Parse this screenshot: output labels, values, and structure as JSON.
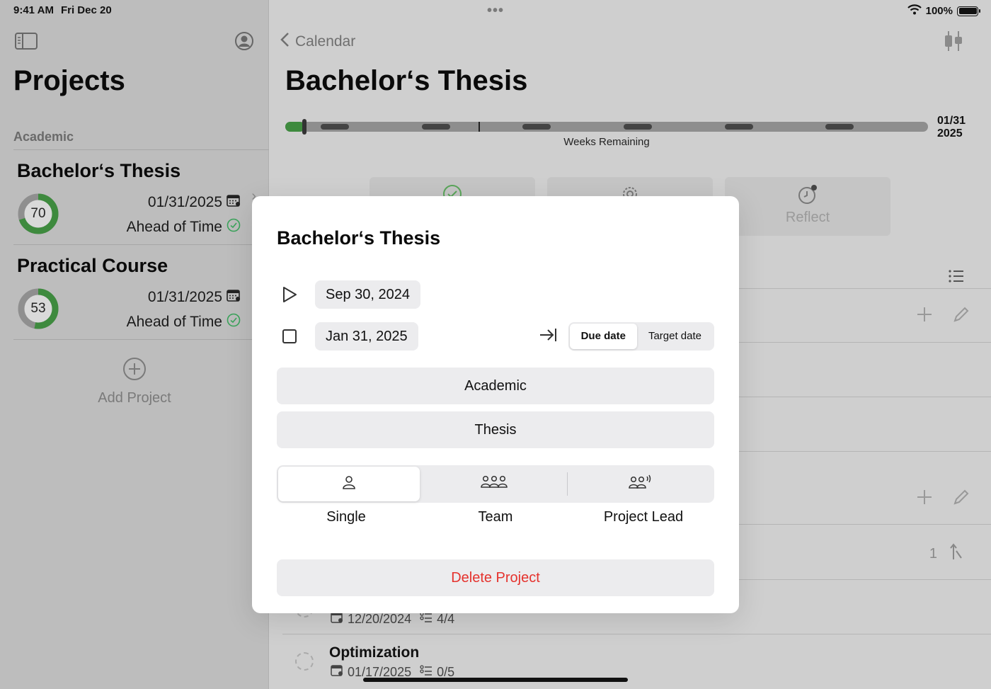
{
  "status_bar": {
    "time": "9:41 AM",
    "date": "Fri Dec 20",
    "battery": "100%"
  },
  "sidebar": {
    "title": "Projects",
    "section": "Academic",
    "projects": [
      {
        "name": "Bachelor‘s Thesis",
        "progress": "70",
        "progress_fraction": 0.7,
        "due": "01/31/2025",
        "status": "Ahead of Time"
      },
      {
        "name": "Practical Course",
        "progress": "53",
        "progress_fraction": 0.53,
        "due": "01/31/2025",
        "status": "Ahead of Time"
      }
    ],
    "add_label": "Add Project"
  },
  "main": {
    "back_label": "Calendar",
    "title": "Bachelor‘s Thesis",
    "timeline": {
      "end_month_day": "01/31",
      "end_year": "2025",
      "label": "Weeks Remaining",
      "elapsed_fraction": 0.03
    },
    "actions": [
      {
        "label": ""
      },
      {
        "label": ""
      },
      {
        "label": "Reflect"
      }
    ],
    "row_count": "1",
    "tasks": [
      {
        "name": "",
        "date": "12/20/2024",
        "subtasks": "4/4"
      },
      {
        "name": "Optimization",
        "date": "01/17/2025",
        "subtasks": "0/5"
      }
    ]
  },
  "modal": {
    "title": "Bachelor‘s Thesis",
    "start_date": "Sep 30, 2024",
    "end_date": "Jan 31, 2025",
    "date_mode": {
      "options": [
        "Due date",
        "Target date"
      ],
      "selected": "Due date"
    },
    "category": "Academic",
    "type": "Thesis",
    "roles": {
      "options": [
        "Single",
        "Team",
        "Project Lead"
      ],
      "selected": "Single"
    },
    "delete_label": "Delete Project"
  },
  "colors": {
    "accent_green": "#3e8a3e",
    "destructive": "#e5322d",
    "status_ok": "#3aa35a"
  }
}
